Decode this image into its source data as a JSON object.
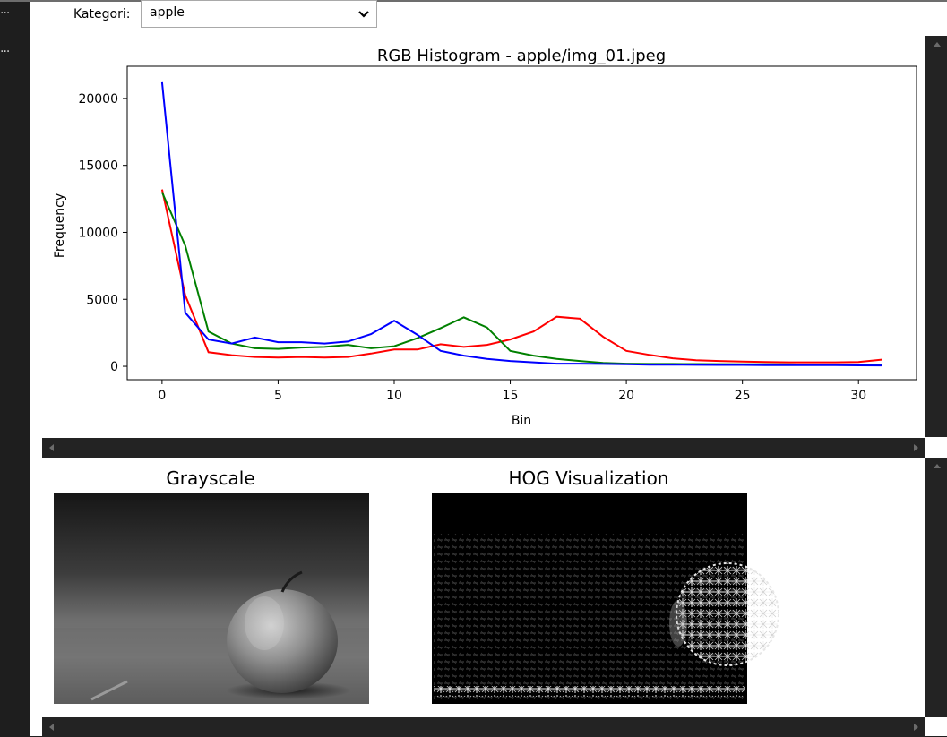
{
  "toolbar": {
    "left_dots": "···"
  },
  "widget": {
    "label": "Kategori:",
    "selected": "apple"
  },
  "histogram": {
    "chart_data": {
      "type": "line",
      "title": "RGB Histogram - apple/img_01.jpeg",
      "xlabel": "Bin",
      "ylabel": "Frequency",
      "xlim": [
        -1.5,
        32.5
      ],
      "ylim": [
        -1000,
        22400
      ],
      "xticks": [
        0,
        5,
        10,
        15,
        20,
        25,
        30
      ],
      "yticks": [
        0,
        5000,
        10000,
        15000,
        20000
      ],
      "x": [
        0,
        1,
        2,
        3,
        4,
        5,
        6,
        7,
        8,
        9,
        10,
        11,
        12,
        13,
        14,
        15,
        16,
        17,
        18,
        19,
        20,
        21,
        22,
        23,
        24,
        25,
        26,
        27,
        28,
        29,
        30,
        31
      ],
      "series": [
        {
          "color": "#ff0000",
          "values": [
            13200,
            5300,
            1050,
            830,
            700,
            650,
            700,
            650,
            700,
            950,
            1250,
            1250,
            1650,
            1450,
            1600,
            2000,
            2600,
            3700,
            3550,
            2200,
            1150,
            850,
            600,
            450,
            400,
            350,
            320,
            300,
            300,
            300,
            320,
            500
          ]
        },
        {
          "color": "#008000",
          "values": [
            13000,
            9000,
            2600,
            1700,
            1350,
            1300,
            1400,
            1450,
            1600,
            1350,
            1500,
            2100,
            2850,
            3650,
            2900,
            1150,
            800,
            550,
            400,
            250,
            200,
            180,
            180,
            170,
            160,
            150,
            150,
            140,
            130,
            120,
            110,
            100
          ]
        },
        {
          "color": "#0000ff",
          "values": [
            21200,
            4000,
            2000,
            1700,
            2150,
            1800,
            1800,
            1700,
            1850,
            2400,
            3400,
            2350,
            1150,
            800,
            550,
            400,
            300,
            200,
            200,
            180,
            150,
            120,
            120,
            110,
            100,
            100,
            90,
            90,
            80,
            80,
            70,
            60
          ]
        }
      ]
    }
  },
  "images": {
    "grayscale_title": "Grayscale",
    "hog_title": "HOG Visualization"
  }
}
